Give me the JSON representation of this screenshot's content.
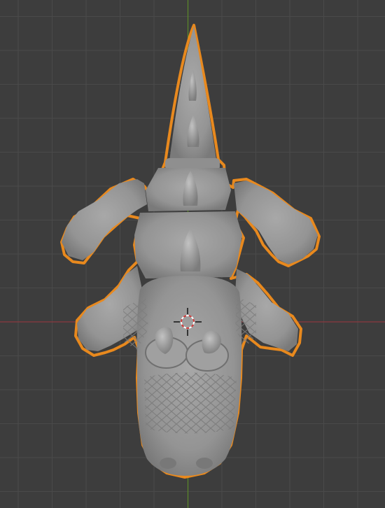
{
  "viewport": {
    "background": "#3d3d3d",
    "grid_color": "#4a4a4a",
    "x_axis_color": "#8c3a3f",
    "y_axis_color": "#5a8a2a",
    "selection_outline": "#e8891e",
    "mesh_color": "#9b9b9b",
    "mesh_shadow": "#6e6e6e",
    "mesh_highlight": "#b8b8b8"
  },
  "scene": {
    "object": "3d-mesh-crocodile",
    "selected": true,
    "cursor_icon": "3d-cursor-icon"
  }
}
